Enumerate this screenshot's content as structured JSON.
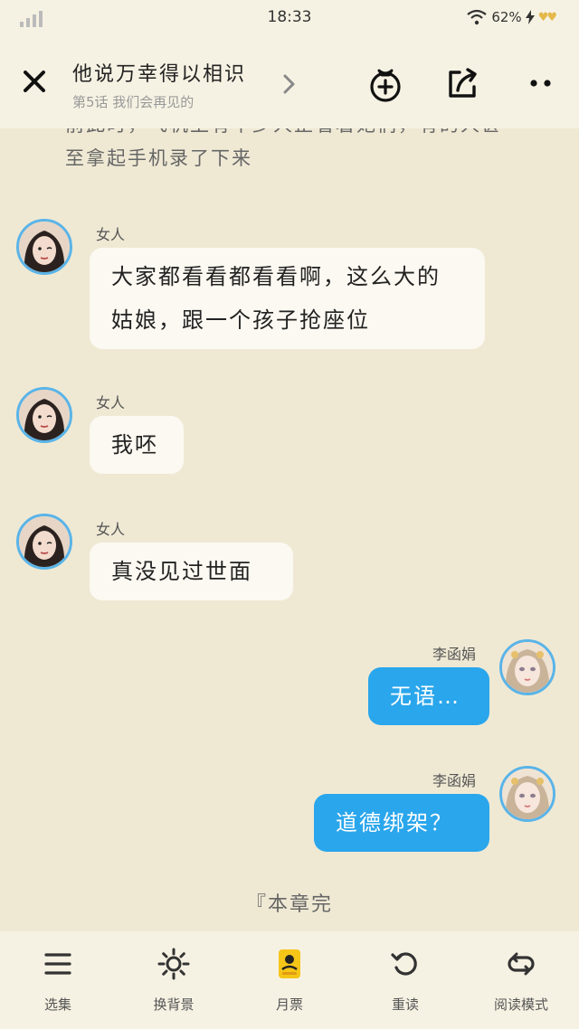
{
  "status_bar": {
    "time": "18:33",
    "battery": "62%"
  },
  "header": {
    "title": "他说万幸得以相识",
    "subtitle": "第5话 我们会再见的"
  },
  "narration": "前此时，飞机上有不少人正看着她们，有的人甚至拿起手机录了下来",
  "messages": [
    {
      "speaker": "女人",
      "text": "大家都看看都看看啊，这么大的姑娘，跟一个孩子抢座位"
    },
    {
      "speaker": "女人",
      "text": "我呸"
    },
    {
      "speaker": "女人",
      "text": "真没见过世面"
    },
    {
      "speaker": "李函娟",
      "text": "无语…"
    },
    {
      "speaker": "李函娟",
      "text": "道德绑架？"
    }
  ],
  "chapter_end": "『本章完",
  "bottom_bar": {
    "items": [
      {
        "label": "选集",
        "icon": "menu-icon"
      },
      {
        "label": "换背景",
        "icon": "sun-icon"
      },
      {
        "label": "月票",
        "icon": "ticket-icon"
      },
      {
        "label": "重读",
        "icon": "undo-icon"
      },
      {
        "label": "阅读模式",
        "icon": "loop-icon"
      }
    ]
  },
  "colors": {
    "background": "#efe9d4",
    "bar": "#f6f2e3",
    "my_bubble": "#2aa6ec",
    "other_bubble": "#fbf9f1",
    "avatar_ring": "#5ab4e8"
  }
}
